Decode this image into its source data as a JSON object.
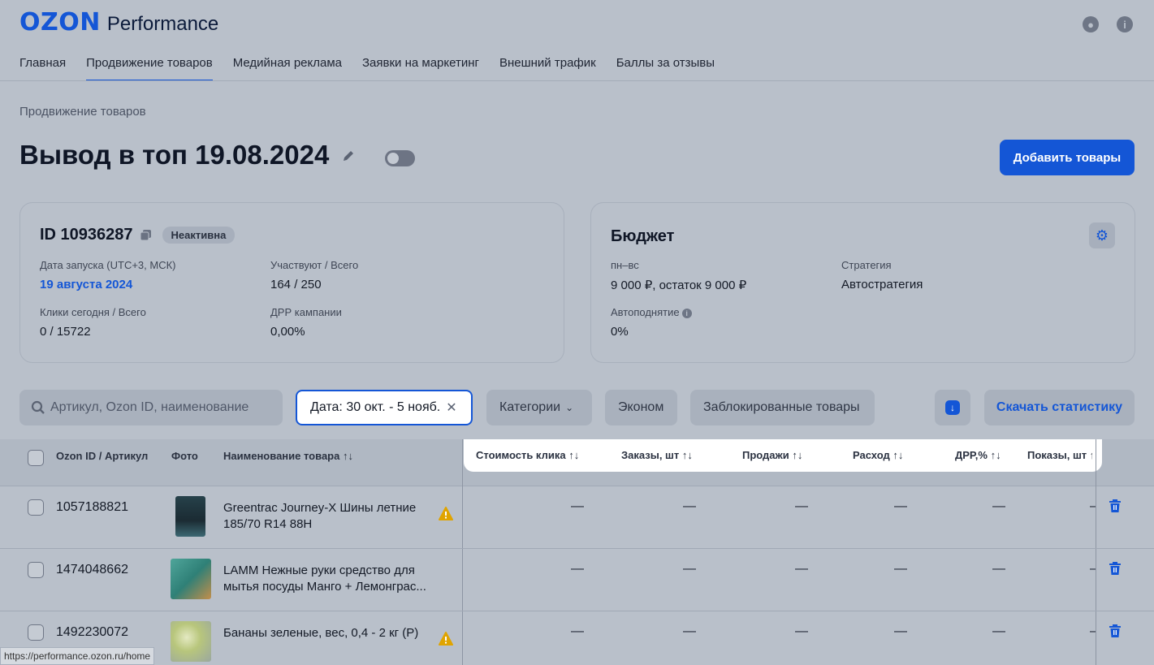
{
  "brand": {
    "ozon": "OZON",
    "product": "Performance"
  },
  "header_icons": [
    "user-icon",
    "info-icon"
  ],
  "nav": {
    "items": [
      {
        "label": "Главная"
      },
      {
        "label": "Продвижение товаров",
        "active": true
      },
      {
        "label": "Медийная реклама"
      },
      {
        "label": "Заявки на маркетинг"
      },
      {
        "label": "Внешний трафик"
      },
      {
        "label": "Баллы за отзывы"
      }
    ]
  },
  "breadcrumb": "Продвижение товаров",
  "page": {
    "title": "Вывод в топ 19.08.2024",
    "toggle_on": false,
    "add_button": "Добавить товары"
  },
  "campaign": {
    "id": "ID 10936287",
    "status": "Неактивна",
    "launch_label": "Дата запуска (UTC+3, МСК)",
    "launch_value": "19 августа 2024",
    "participants_label": "Участвуют / Всего",
    "participants_value": "164 / 250",
    "clicks_label": "Клики сегодня / Всего",
    "clicks_value": "0 / 15722",
    "drr_label": "ДРР кампании",
    "drr_value": "0,00%"
  },
  "budget": {
    "title": "Бюджет",
    "period_label": "пн–вс",
    "period_value": "9 000 ₽, остаток 9 000 ₽",
    "strategy_label": "Стратегия",
    "strategy_value": "Автостратегия",
    "autolift_label": "Автоподнятие",
    "autolift_value": "0%"
  },
  "toolbar": {
    "search_placeholder": "Артикул, Ozon ID, наименование",
    "date_chip": "Дата: 30 окт. - 5 нояб.",
    "categories": "Категории",
    "econom": "Эконом",
    "blocked": "Заблокированные товары",
    "download_stats": "Скачать статистику"
  },
  "table": {
    "headers": {
      "id": "Ozon ID / Артикул",
      "photo": "Фото",
      "name": "Наименование товара ↑↓",
      "click_cost": "Стоимость клика ↑↓",
      "orders": "Заказы, шт ↑↓",
      "sales": "Продажи ↑↓",
      "spend": "Расход ↑↓",
      "drr": "ДРР,% ↑↓",
      "impressions": "Показы, шт ↑"
    },
    "rows": [
      {
        "id": "1057188821",
        "name": "Greentrac Journey-X Шины летние 185/70 R14 88H",
        "warning": true,
        "values": [
          "—",
          "—",
          "—",
          "—",
          "—",
          "—"
        ]
      },
      {
        "id": "1474048662",
        "name": "LAMM Нежные руки средство для мытья посуды Манго + Лемонграс...",
        "warning": false,
        "values": [
          "—",
          "—",
          "—",
          "—",
          "—",
          "—"
        ]
      },
      {
        "id": "1492230072",
        "name": "Бананы зеленые, вес, 0,4 - 2 кг (Р)",
        "warning": true,
        "values": [
          "—",
          "—",
          "—",
          "—",
          "—",
          "—"
        ]
      }
    ]
  },
  "status_url": "https://performance.ozon.ru/home",
  "colors": {
    "accent": "#1456d6",
    "warning": "#e0a400"
  }
}
